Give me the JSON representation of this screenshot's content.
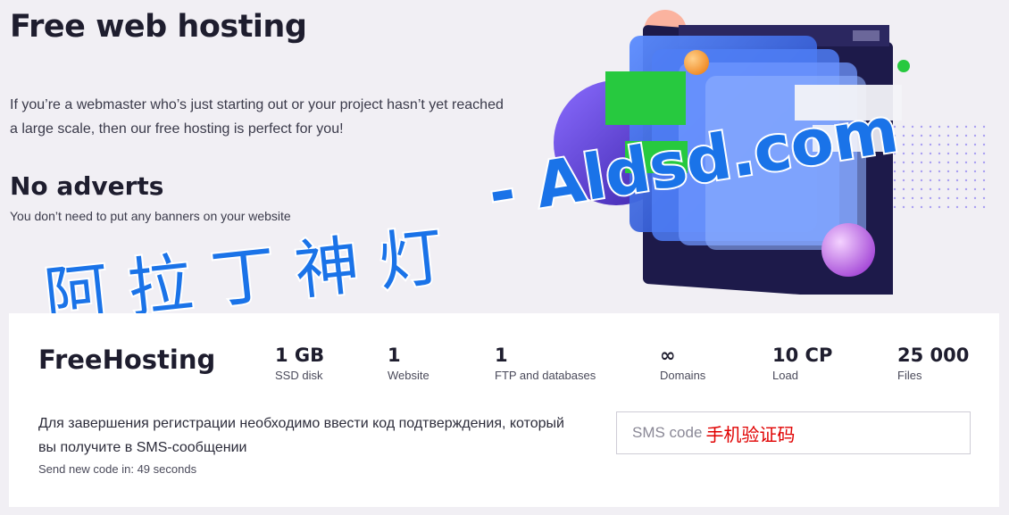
{
  "hero": {
    "title": "Free web hosting",
    "description": "If you’re a webmaster who’s just starting out or your project hasn’t yet reached a large scale, then our free hosting is perfect for you!"
  },
  "feature": {
    "title": "No adverts",
    "description": "You don’t need to put any banners on your website"
  },
  "watermark": {
    "cn": "阿拉丁神灯",
    "en": "- Aldsd.com"
  },
  "plan": {
    "name": "FreeHosting",
    "specs": [
      {
        "value": "1 GB",
        "label": "SSD disk"
      },
      {
        "value": "1",
        "label": "Website"
      },
      {
        "value": "1",
        "label": "FTP and databases"
      },
      {
        "value": "∞",
        "label": "Domains"
      },
      {
        "value": "10 CP",
        "label": "Load"
      },
      {
        "value": "25 000",
        "label": "Files"
      }
    ],
    "notice": "Для завершения регистрации необходимо ввести код подтверждения, который вы получите в SMS-сообщении",
    "resend_prefix": "Send new code in: ",
    "resend_seconds": "49 seconds",
    "sms_placeholder": "SMS code",
    "sms_annotation": "手机验证码"
  },
  "colors": {
    "background": "#f1eff4",
    "card": "#ffffff",
    "watermark": "#1a73e8",
    "annotation": "#e00000"
  }
}
